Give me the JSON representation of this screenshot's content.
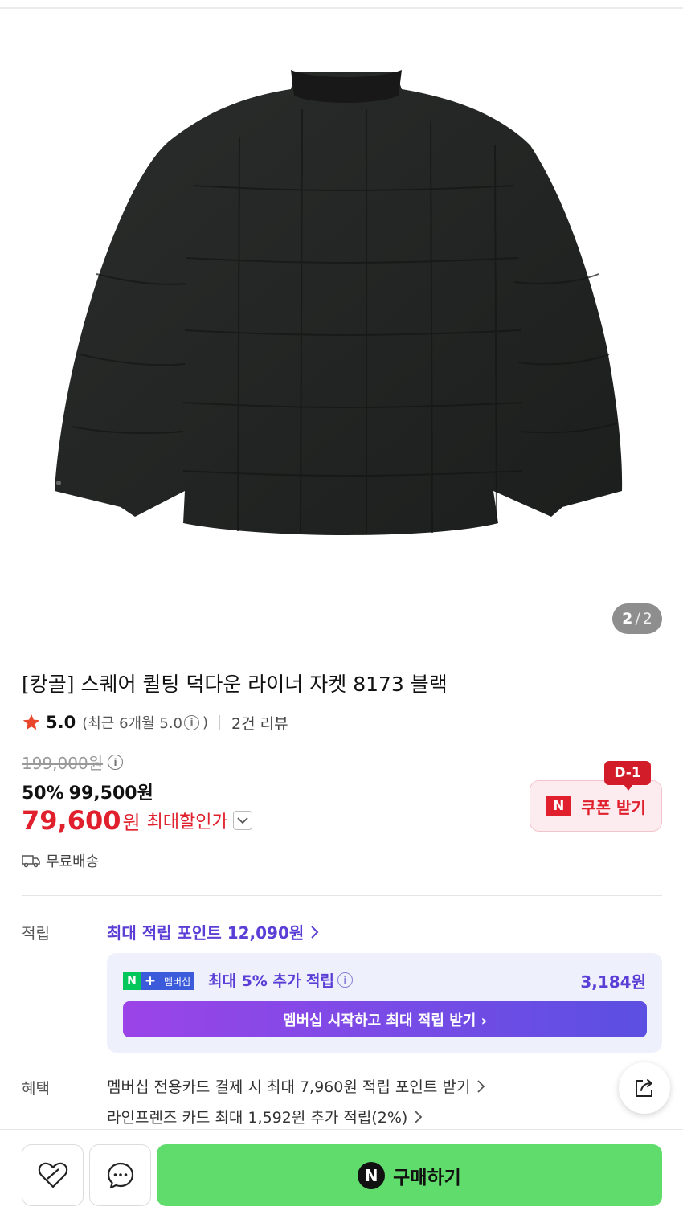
{
  "gallery": {
    "current": "2",
    "separator": "/",
    "total": "2"
  },
  "product": {
    "title": "[캉골] 스퀘어 퀼팅 덕다운 라이너 자켓 8173 블랙"
  },
  "rating": {
    "score": "5.0",
    "recent_label": "(최근 6개월 5.0",
    "recent_close": ")",
    "review_link": "2건 리뷰",
    "star_color": "#e9462c"
  },
  "price": {
    "original": "199,000원",
    "discount_pct": "50%",
    "sale": "99,500원",
    "max_discount_price": "79,600",
    "max_discount_won": "원",
    "max_discount_label": "최대할인가"
  },
  "coupon": {
    "dday": "D-1",
    "badge": "N",
    "label": "쿠폰 받기"
  },
  "shipping": {
    "label": "무료배송"
  },
  "points": {
    "section_label": "적립",
    "link": "최대 적립 포인트 12,090원",
    "membership": {
      "badge_n": "N",
      "badge_plus": "+",
      "badge_text": "멤버십",
      "text": "최대 5% 추가 적립",
      "amount": "3,184원",
      "cta": "멤버십 시작하고 최대 적립 받기 ›"
    }
  },
  "benefits": {
    "section_label": "혜택",
    "items": [
      "멤버십 전용카드 결제 시 최대 7,960원 적립 포인트 받기",
      "라인프렌즈 카드 최대 1,592원 추가 적립(2%)"
    ]
  },
  "bottom": {
    "buy_badge": "N",
    "buy_label": "구매하기"
  },
  "icons": [
    "heart-icon",
    "chat-icon",
    "share-icon",
    "truck-icon",
    "info-icon",
    "chevron-down-icon",
    "chevron-right-icon",
    "star-icon"
  ],
  "colors": {
    "accent_red": "#e0202d",
    "accent_purple": "#5b3ed6",
    "buy_green": "#5fdc6b",
    "naver_green": "#03c75a"
  }
}
